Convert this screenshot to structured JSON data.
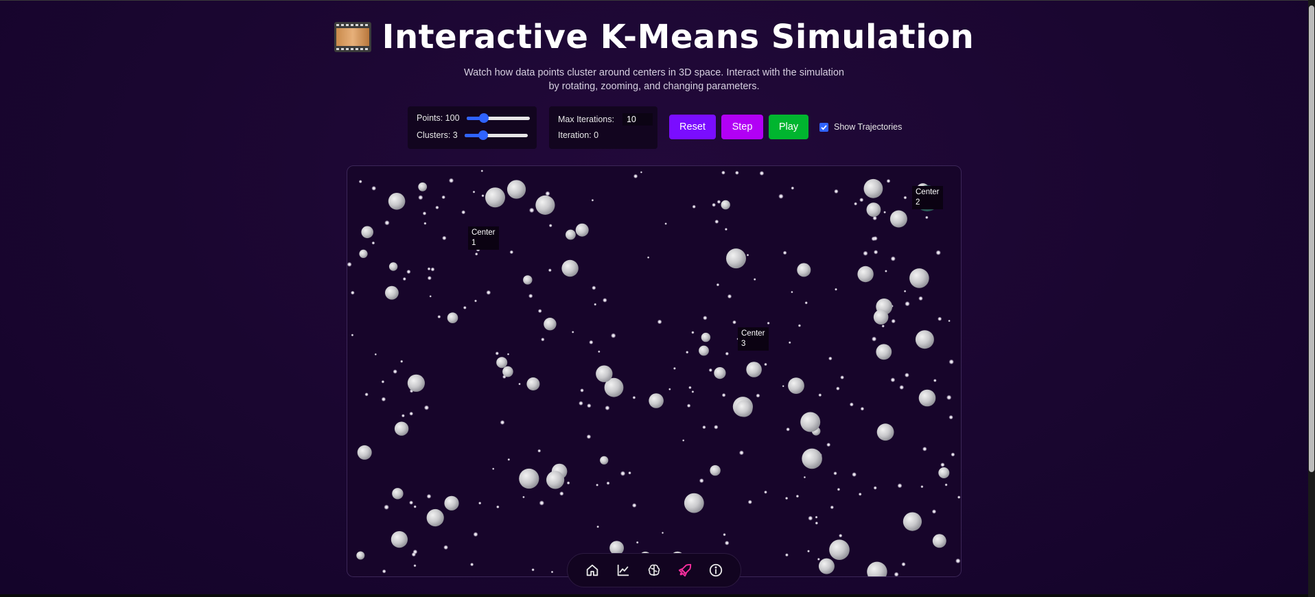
{
  "title": "Interactive K-Means Simulation",
  "subtitle": "Watch how data points cluster around centers in 3D space. Interact with the simulation by rotating, zooming, and changing parameters.",
  "controls": {
    "points_label": "Points: 100",
    "points_value": 100,
    "points_slider_fraction": 0.28,
    "clusters_label": "Clusters: 3",
    "clusters_value": 3,
    "clusters_slider_fraction": 0.3,
    "max_iterations_label": "Max Iterations:",
    "max_iterations_value": "10",
    "iteration_status": "Iteration: 0",
    "reset_label": "Reset",
    "step_label": "Step",
    "play_label": "Play",
    "show_trajectories_label": "Show Trajectories",
    "show_trajectories_checked": true
  },
  "centers": [
    {
      "label": "Center 1",
      "line1": "Center",
      "line2": "1",
      "color": "#8a2a55"
    },
    {
      "label": "Center 2",
      "line1": "Center",
      "line2": "2",
      "color": "#2f6a5e"
    },
    {
      "label": "Center 3",
      "line1": "Center",
      "line2": "3",
      "color": "#6c6a1a"
    }
  ],
  "dock": {
    "items": [
      {
        "name": "home-icon",
        "active": false
      },
      {
        "name": "chart-icon",
        "active": false
      },
      {
        "name": "brain-icon",
        "active": false
      },
      {
        "name": "rocket-icon",
        "active": true
      },
      {
        "name": "info-icon",
        "active": false
      }
    ]
  },
  "colors": {
    "background": "#1a0630",
    "reset": "#7a0dff",
    "step": "#b200f5",
    "play": "#00b52f",
    "accent": "#2f63ff",
    "active_dock": "#ff2fa0"
  }
}
